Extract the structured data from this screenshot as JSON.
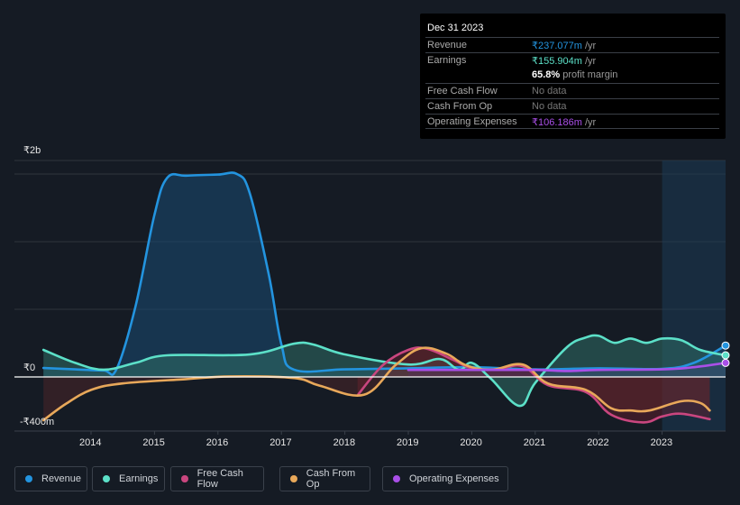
{
  "tooltip": {
    "date": "Dec 31 2023",
    "rows": [
      {
        "label": "Revenue",
        "value": "₹237.077m",
        "unit": " /yr",
        "color": "#2394df"
      },
      {
        "label": "Earnings",
        "value": "₹155.904m",
        "unit": " /yr",
        "color": "#5ce0c8"
      },
      {
        "label": "",
        "value": "65.8%",
        "unit": " profit margin",
        "color": "#ffffff"
      },
      {
        "label": "Free Cash Flow",
        "value": "No data",
        "unit": "",
        "color": "#777777"
      },
      {
        "label": "Cash From Op",
        "value": "No data",
        "unit": "",
        "color": "#777777"
      },
      {
        "label": "Operating Expenses",
        "value": "₹106.186m",
        "unit": " /yr",
        "color": "#a94fe8"
      }
    ]
  },
  "legend": [
    {
      "label": "Revenue",
      "color": "#2394df"
    },
    {
      "label": "Earnings",
      "color": "#5ce0c8"
    },
    {
      "label": "Free Cash Flow",
      "color": "#c9467f"
    },
    {
      "label": "Cash From Op",
      "color": "#e8a85a"
    },
    {
      "label": "Operating Expenses",
      "color": "#a94fe8"
    }
  ],
  "chart_data": {
    "type": "area",
    "title": "",
    "xlabel": "",
    "ylabel": "",
    "y_unit": "₹m",
    "ylim": [
      -500,
      2000
    ],
    "xlim": [
      2013.0,
      2024.0
    ],
    "y_tick_labels": [
      {
        "value": 2000,
        "label": "₹2b"
      },
      {
        "value": 0,
        "label": "₹0"
      },
      {
        "value": -400,
        "label": "-₹400m"
      }
    ],
    "x_ticks": [
      2014,
      2015,
      2016,
      2017,
      2018,
      2019,
      2020,
      2021,
      2022,
      2023
    ],
    "x_tick_labels": [
      "2014",
      "2015",
      "2016",
      "2017",
      "2018",
      "2019",
      "2020",
      "2021",
      "2022",
      "2023"
    ],
    "highlight_range": [
      2023.0,
      2024.0
    ],
    "legend_position": "bottom",
    "series": [
      {
        "name": "Revenue",
        "color": "#2394df",
        "x": [
          2013.25,
          2013.75,
          2014.2,
          2014.4,
          2014.7,
          2015.0,
          2015.2,
          2015.5,
          2016.0,
          2016.3,
          2016.5,
          2016.8,
          2017.0,
          2017.2,
          2018.0,
          2019.0,
          2020.0,
          2021.0,
          2022.0,
          2023.0,
          2023.5,
          2024.0
        ],
        "y": [
          83,
          70,
          60,
          70,
          650,
          1500,
          1840,
          1860,
          1870,
          1875,
          1700,
          950,
          300,
          67,
          70,
          80,
          90,
          70,
          80,
          75,
          130,
          290
        ]
      },
      {
        "name": "Earnings",
        "color": "#5ce0c8",
        "x": [
          2013.25,
          2013.75,
          2014.2,
          2014.7,
          2015.2,
          2016.5,
          2017.2,
          2017.5,
          2018.0,
          2019.0,
          2019.5,
          2019.8,
          2020.0,
          2020.3,
          2020.75,
          2021.0,
          2021.5,
          2021.8,
          2022.0,
          2022.25,
          2022.5,
          2022.75,
          2023.0,
          2023.3,
          2023.6,
          2024.0
        ],
        "y": [
          250,
          130,
          67,
          130,
          200,
          208,
          308,
          300,
          208,
          115,
          165,
          65,
          130,
          -15,
          -267,
          -55,
          275,
          365,
          380,
          315,
          355,
          315,
          355,
          340,
          250,
          200
        ]
      },
      {
        "name": "Free Cash Flow",
        "color": "#c9467f",
        "x": [
          2018.2,
          2018.6,
          2019.0,
          2019.3,
          2019.7,
          2020.0,
          2020.4,
          2020.8,
          2021.2,
          2021.8,
          2022.2,
          2022.7,
          2023.0,
          2023.3,
          2023.75
        ],
        "y": [
          -170,
          110,
          250,
          260,
          160,
          80,
          70,
          100,
          -75,
          -140,
          -350,
          -420,
          -365,
          -340,
          -390
        ]
      },
      {
        "name": "Cash From Op",
        "color": "#e8a85a",
        "x": [
          2013.25,
          2013.6,
          2014.0,
          2014.5,
          2015.5,
          2016.2,
          2017.2,
          2017.6,
          2018.3,
          2018.8,
          2019.2,
          2019.6,
          2019.9,
          2020.3,
          2020.8,
          2021.2,
          2021.8,
          2022.2,
          2022.5,
          2022.8,
          2023.3,
          2023.6,
          2023.75
        ],
        "y": [
          -400,
          -250,
          -120,
          -60,
          -20,
          5,
          -10,
          -80,
          -165,
          110,
          265,
          215,
          110,
          65,
          115,
          -60,
          -120,
          -290,
          -310,
          -310,
          -225,
          -240,
          -310
        ]
      },
      {
        "name": "Operating Expenses",
        "color": "#a94fe8",
        "x": [
          2019.0,
          2020.0,
          2021.0,
          2021.5,
          2022.0,
          2023.0,
          2023.5,
          2024.0
        ],
        "y": [
          65,
          65,
          65,
          55,
          65,
          70,
          90,
          130
        ]
      }
    ]
  }
}
